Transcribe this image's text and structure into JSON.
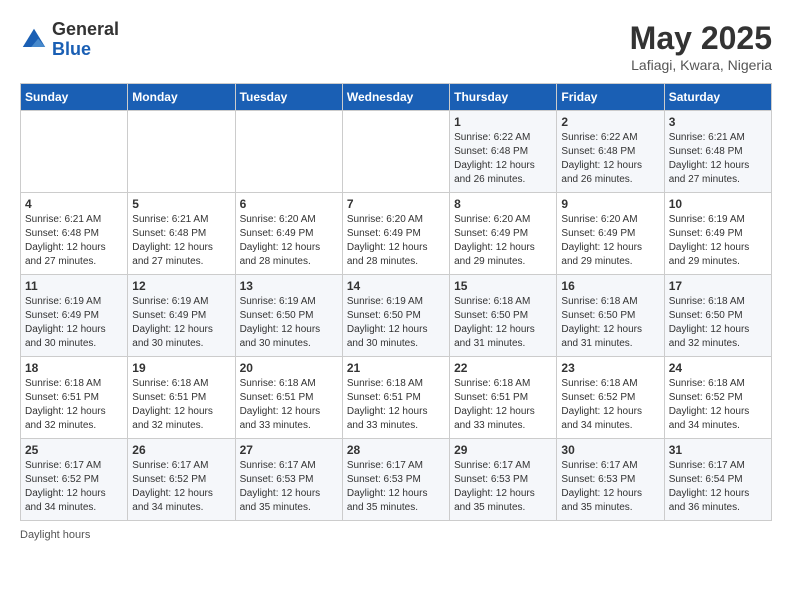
{
  "header": {
    "logo_general": "General",
    "logo_blue": "Blue",
    "month_year": "May 2025",
    "location": "Lafiagi, Kwara, Nigeria"
  },
  "days_of_week": [
    "Sunday",
    "Monday",
    "Tuesday",
    "Wednesday",
    "Thursday",
    "Friday",
    "Saturday"
  ],
  "weeks": [
    [
      {
        "day": "",
        "info": ""
      },
      {
        "day": "",
        "info": ""
      },
      {
        "day": "",
        "info": ""
      },
      {
        "day": "",
        "info": ""
      },
      {
        "day": "1",
        "info": "Sunrise: 6:22 AM\nSunset: 6:48 PM\nDaylight: 12 hours and 26 minutes."
      },
      {
        "day": "2",
        "info": "Sunrise: 6:22 AM\nSunset: 6:48 PM\nDaylight: 12 hours and 26 minutes."
      },
      {
        "day": "3",
        "info": "Sunrise: 6:21 AM\nSunset: 6:48 PM\nDaylight: 12 hours and 27 minutes."
      }
    ],
    [
      {
        "day": "4",
        "info": "Sunrise: 6:21 AM\nSunset: 6:48 PM\nDaylight: 12 hours and 27 minutes."
      },
      {
        "day": "5",
        "info": "Sunrise: 6:21 AM\nSunset: 6:48 PM\nDaylight: 12 hours and 27 minutes."
      },
      {
        "day": "6",
        "info": "Sunrise: 6:20 AM\nSunset: 6:49 PM\nDaylight: 12 hours and 28 minutes."
      },
      {
        "day": "7",
        "info": "Sunrise: 6:20 AM\nSunset: 6:49 PM\nDaylight: 12 hours and 28 minutes."
      },
      {
        "day": "8",
        "info": "Sunrise: 6:20 AM\nSunset: 6:49 PM\nDaylight: 12 hours and 29 minutes."
      },
      {
        "day": "9",
        "info": "Sunrise: 6:20 AM\nSunset: 6:49 PM\nDaylight: 12 hours and 29 minutes."
      },
      {
        "day": "10",
        "info": "Sunrise: 6:19 AM\nSunset: 6:49 PM\nDaylight: 12 hours and 29 minutes."
      }
    ],
    [
      {
        "day": "11",
        "info": "Sunrise: 6:19 AM\nSunset: 6:49 PM\nDaylight: 12 hours and 30 minutes."
      },
      {
        "day": "12",
        "info": "Sunrise: 6:19 AM\nSunset: 6:49 PM\nDaylight: 12 hours and 30 minutes."
      },
      {
        "day": "13",
        "info": "Sunrise: 6:19 AM\nSunset: 6:50 PM\nDaylight: 12 hours and 30 minutes."
      },
      {
        "day": "14",
        "info": "Sunrise: 6:19 AM\nSunset: 6:50 PM\nDaylight: 12 hours and 30 minutes."
      },
      {
        "day": "15",
        "info": "Sunrise: 6:18 AM\nSunset: 6:50 PM\nDaylight: 12 hours and 31 minutes."
      },
      {
        "day": "16",
        "info": "Sunrise: 6:18 AM\nSunset: 6:50 PM\nDaylight: 12 hours and 31 minutes."
      },
      {
        "day": "17",
        "info": "Sunrise: 6:18 AM\nSunset: 6:50 PM\nDaylight: 12 hours and 32 minutes."
      }
    ],
    [
      {
        "day": "18",
        "info": "Sunrise: 6:18 AM\nSunset: 6:51 PM\nDaylight: 12 hours and 32 minutes."
      },
      {
        "day": "19",
        "info": "Sunrise: 6:18 AM\nSunset: 6:51 PM\nDaylight: 12 hours and 32 minutes."
      },
      {
        "day": "20",
        "info": "Sunrise: 6:18 AM\nSunset: 6:51 PM\nDaylight: 12 hours and 33 minutes."
      },
      {
        "day": "21",
        "info": "Sunrise: 6:18 AM\nSunset: 6:51 PM\nDaylight: 12 hours and 33 minutes."
      },
      {
        "day": "22",
        "info": "Sunrise: 6:18 AM\nSunset: 6:51 PM\nDaylight: 12 hours and 33 minutes."
      },
      {
        "day": "23",
        "info": "Sunrise: 6:18 AM\nSunset: 6:52 PM\nDaylight: 12 hours and 34 minutes."
      },
      {
        "day": "24",
        "info": "Sunrise: 6:18 AM\nSunset: 6:52 PM\nDaylight: 12 hours and 34 minutes."
      }
    ],
    [
      {
        "day": "25",
        "info": "Sunrise: 6:17 AM\nSunset: 6:52 PM\nDaylight: 12 hours and 34 minutes."
      },
      {
        "day": "26",
        "info": "Sunrise: 6:17 AM\nSunset: 6:52 PM\nDaylight: 12 hours and 34 minutes."
      },
      {
        "day": "27",
        "info": "Sunrise: 6:17 AM\nSunset: 6:53 PM\nDaylight: 12 hours and 35 minutes."
      },
      {
        "day": "28",
        "info": "Sunrise: 6:17 AM\nSunset: 6:53 PM\nDaylight: 12 hours and 35 minutes."
      },
      {
        "day": "29",
        "info": "Sunrise: 6:17 AM\nSunset: 6:53 PM\nDaylight: 12 hours and 35 minutes."
      },
      {
        "day": "30",
        "info": "Sunrise: 6:17 AM\nSunset: 6:53 PM\nDaylight: 12 hours and 35 minutes."
      },
      {
        "day": "31",
        "info": "Sunrise: 6:17 AM\nSunset: 6:54 PM\nDaylight: 12 hours and 36 minutes."
      }
    ]
  ],
  "footer": {
    "daylight_label": "Daylight hours"
  }
}
